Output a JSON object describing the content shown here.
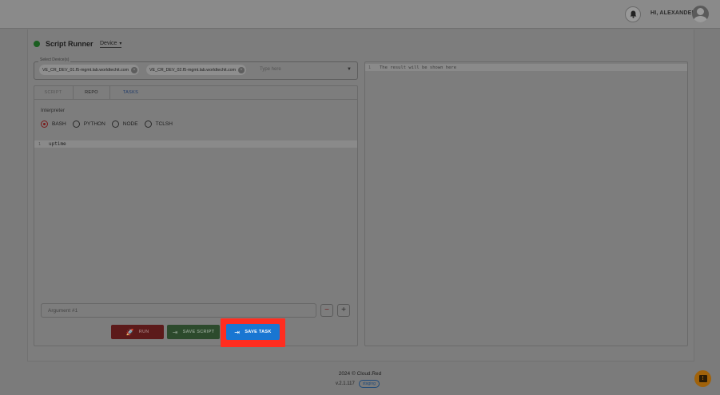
{
  "header": {
    "greeting": "HI, ALEXANDER",
    "bell_icon": "bell-icon",
    "avatar_icon": "account-circle-icon"
  },
  "runner": {
    "title": "Script Runner",
    "status_color": "#1b5e20",
    "mode_dropdown": "Device"
  },
  "device_select": {
    "label": "Select Device(s)",
    "chips": [
      "VE_CR_DEV_01.f5-mgmt.lab.worldtechit.com",
      "VE_CR_DEV_02.f5-mgmt.lab.worldtechit.com"
    ],
    "placeholder": "Type here"
  },
  "tabs": [
    {
      "label": "SCRIPT"
    },
    {
      "label": "REPO"
    },
    {
      "label": "TASKS"
    }
  ],
  "interpreter": {
    "label": "Interpreter",
    "options": [
      "BASH",
      "PYTHON",
      "NODE",
      "TCLSH"
    ],
    "selected": "BASH"
  },
  "editor": {
    "line_number": "1",
    "code": "uptime"
  },
  "argument": {
    "placeholder": "Argument #1",
    "minus_label": "−",
    "plus_label": "+"
  },
  "actions": {
    "run_label": "RUN",
    "save_script_label": "SAVE SCRIPT",
    "save_task_label": "SAVE TASK",
    "save_task_color": "#1976d2",
    "highlight_color": "#ff2d20"
  },
  "result": {
    "line_number": "1",
    "placeholder": "The result will be shown here"
  },
  "footer": {
    "copyright": "2024 © Cloud.Red",
    "version": "v.2.1.117",
    "env_badge": "staging"
  }
}
